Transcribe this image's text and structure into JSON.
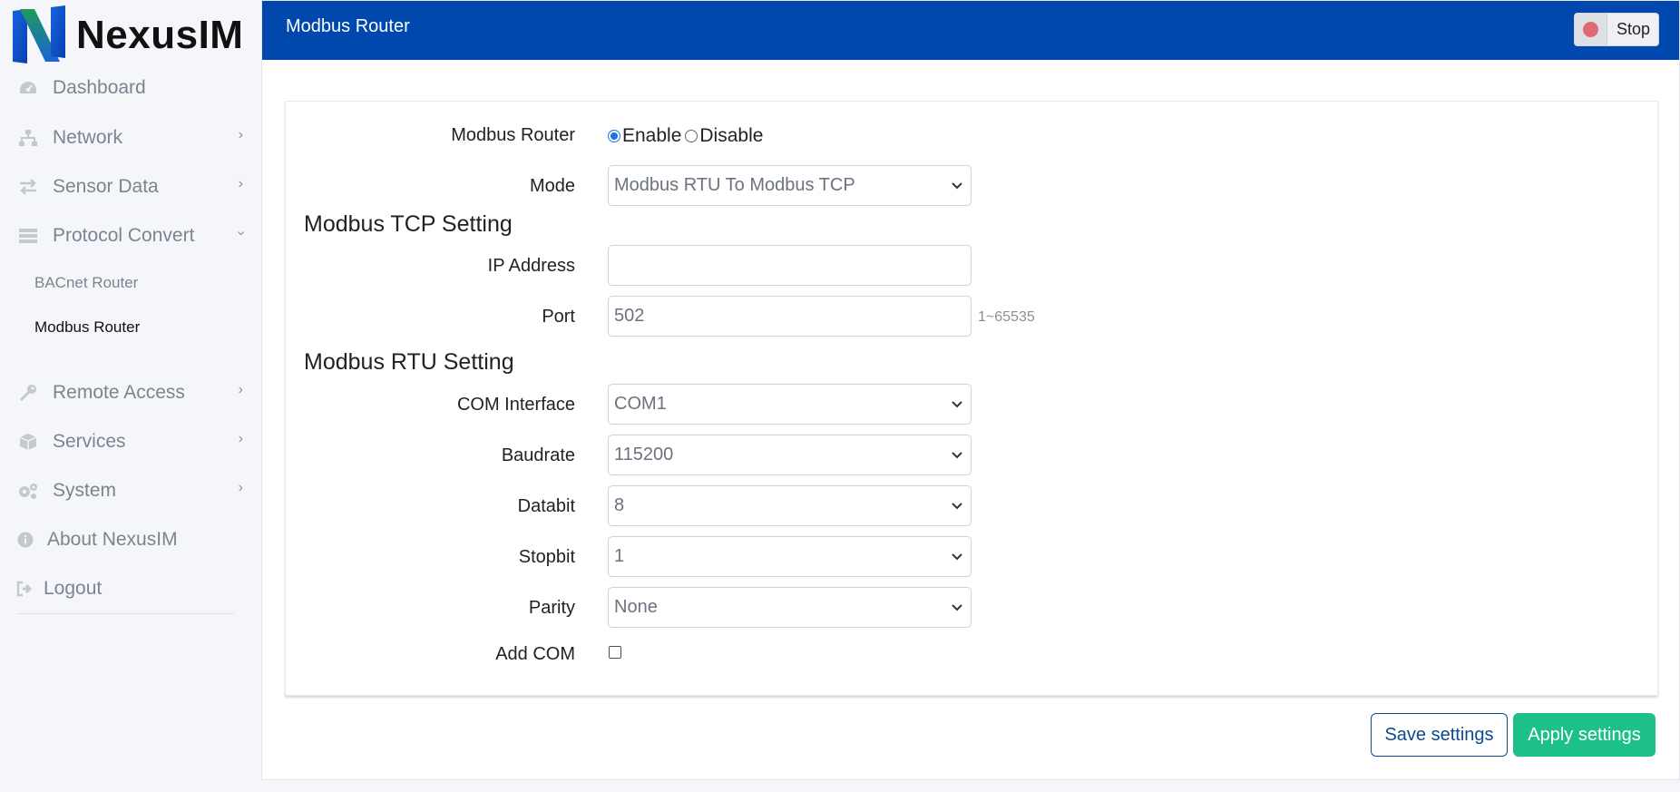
{
  "brand": {
    "name": "NexusIM"
  },
  "sidebar": {
    "items": [
      {
        "label": "Dashboard",
        "icon": "dashboard-icon"
      },
      {
        "label": "Network",
        "icon": "network-icon"
      },
      {
        "label": "Sensor Data",
        "icon": "exchange-icon"
      },
      {
        "label": "Protocol Convert",
        "icon": "server-icon"
      },
      {
        "label": "Remote Access",
        "icon": "key-icon"
      },
      {
        "label": "Services",
        "icon": "box-icon"
      },
      {
        "label": "System",
        "icon": "gears-icon"
      },
      {
        "label": "About NexusIM",
        "icon": "info-icon"
      },
      {
        "label": "Logout",
        "icon": "logout-icon"
      }
    ],
    "subitems": [
      {
        "label": "BACnet Router"
      },
      {
        "label": "Modbus Router"
      }
    ]
  },
  "header": {
    "title": "Modbus Router",
    "stop_label": "Stop"
  },
  "form": {
    "router_label": "Modbus Router",
    "enable_label": "Enable",
    "disable_label": "Disable",
    "router_state": "Enable",
    "mode_label": "Mode",
    "mode_value": "Modbus RTU To Modbus TCP",
    "tcp_title": "Modbus TCP Setting",
    "ip_label": "IP Address",
    "ip_value": "",
    "port_label": "Port",
    "port_value": "502",
    "port_hint": "1~65535",
    "rtu_title": "Modbus RTU Setting",
    "com_label": "COM Interface",
    "com_value": "COM1",
    "baud_label": "Baudrate",
    "baud_value": "115200",
    "databit_label": "Databit",
    "databit_value": "8",
    "stopbit_label": "Stopbit",
    "stopbit_value": "1",
    "parity_label": "Parity",
    "parity_value": "None",
    "addcom_label": "Add COM",
    "addcom_checked": false
  },
  "actions": {
    "save_label": "Save settings",
    "apply_label": "Apply settings"
  },
  "colors": {
    "header_bg": "#0048ad",
    "apply_bg": "#1dbf8a",
    "save_border": "#0b4a8f"
  }
}
